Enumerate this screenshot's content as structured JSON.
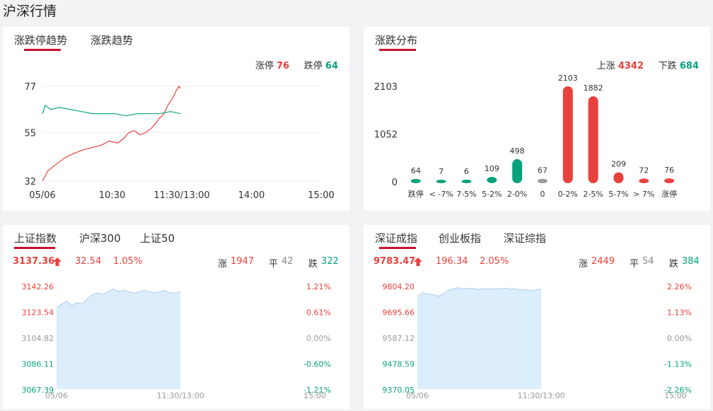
{
  "page_title": "沪深行情",
  "panels": {
    "trend": {
      "tabs": [
        "涨跌停趋势",
        "涨跌趋势"
      ],
      "legend": {
        "up_label": "涨停",
        "up_value": "76",
        "down_label": "跌停",
        "down_value": "64"
      }
    },
    "distribution": {
      "tabs": [
        "涨跌分布"
      ],
      "legend": {
        "up_label": "上涨",
        "up_value": "4342",
        "down_label": "下跌",
        "down_value": "684"
      }
    },
    "sh": {
      "tabs": [
        "上证指数",
        "沪深300",
        "上证50"
      ],
      "price": "3137.36",
      "change": "32.54",
      "pct": "1.05%",
      "up_label": "涨",
      "up_value": "1947",
      "flat_label": "平",
      "flat_value": "42",
      "down_label": "跌",
      "down_value": "322"
    },
    "sz": {
      "tabs": [
        "深证成指",
        "创业板指",
        "深证综指"
      ],
      "price": "9783.47",
      "change": "196.34",
      "pct": "2.05%",
      "up_label": "涨",
      "up_value": "2449",
      "flat_label": "平",
      "flat_value": "54",
      "down_label": "跌",
      "down_value": "384"
    }
  },
  "colors": {
    "up": "#e8413e",
    "down": "#08a27c",
    "flat": "#999999",
    "accent": "#c8102e",
    "area": "#dcedfc",
    "area_line": "#a9cdf0"
  },
  "chart_data": [
    {
      "id": "limit-trend",
      "type": "line",
      "x_ticks": [
        "05/06",
        "10:30",
        "11:30/13:00",
        "14:00",
        "15:00"
      ],
      "y_ticks": [
        77,
        55,
        32
      ],
      "ylim": [
        32,
        77
      ],
      "session_end_fraction": 0.495,
      "series": [
        {
          "color": "#e8413e",
          "points": [
            [
              0,
              32
            ],
            [
              0.02,
              37
            ],
            [
              0.05,
              40
            ],
            [
              0.08,
              43
            ],
            [
              0.11,
              45
            ],
            [
              0.15,
              47
            ],
            [
              0.18,
              48
            ],
            [
              0.21,
              49
            ],
            [
              0.24,
              51
            ],
            [
              0.27,
              50
            ],
            [
              0.29,
              52
            ],
            [
              0.31,
              55
            ],
            [
              0.33,
              56
            ],
            [
              0.35,
              54
            ],
            [
              0.37,
              55
            ],
            [
              0.39,
              57
            ],
            [
              0.41,
              60
            ],
            [
              0.42,
              62
            ],
            [
              0.43,
              63
            ],
            [
              0.44,
              65
            ],
            [
              0.45,
              68
            ],
            [
              0.46,
              70
            ],
            [
              0.47,
              72
            ],
            [
              0.48,
              75
            ],
            [
              0.49,
              77
            ],
            [
              0.495,
              76
            ]
          ]
        },
        {
          "color": "#08a27c",
          "points": [
            [
              0,
              64
            ],
            [
              0.01,
              68
            ],
            [
              0.03,
              66
            ],
            [
              0.06,
              67
            ],
            [
              0.1,
              66
            ],
            [
              0.14,
              65
            ],
            [
              0.18,
              64
            ],
            [
              0.22,
              64
            ],
            [
              0.26,
              64
            ],
            [
              0.3,
              63
            ],
            [
              0.34,
              64
            ],
            [
              0.38,
              64
            ],
            [
              0.42,
              64
            ],
            [
              0.46,
              65
            ],
            [
              0.495,
              64
            ]
          ]
        }
      ]
    },
    {
      "id": "distribution",
      "type": "bar",
      "categories": [
        "跌停",
        "< -7%",
        "7-5%",
        "5-2%",
        "2-0%",
        "0",
        "0-2%",
        "2-5%",
        "5-7%",
        "> 7%",
        "涨停"
      ],
      "values": [
        64,
        7,
        6,
        109,
        498,
        67,
        2103,
        1882,
        209,
        72,
        76
      ],
      "bar_colors": [
        "#08a27c",
        "#08a27c",
        "#08a27c",
        "#08a27c",
        "#08a27c",
        "#999999",
        "#e8413e",
        "#e8413e",
        "#e8413e",
        "#e8413e",
        "#e8413e"
      ],
      "y_ticks": [
        2103,
        1052,
        0
      ],
      "ylim": [
        0,
        2103
      ]
    },
    {
      "id": "sh-intraday",
      "type": "area",
      "x_ticks": [
        "05/06",
        "11:30/13:00",
        "15:00"
      ],
      "y_ticks_left": [
        "3142.26",
        "3123.54",
        "3104.82",
        "3086.11",
        "3067.39"
      ],
      "y_ticks_right": [
        "1.21%",
        "0.61%",
        "0.00%",
        "-0.60%",
        "-1.21%"
      ],
      "ylim": [
        3067.39,
        3142.26
      ],
      "session_end_fraction": 0.48,
      "points": [
        [
          0,
          3126
        ],
        [
          0.02,
          3129
        ],
        [
          0.04,
          3131
        ],
        [
          0.06,
          3128
        ],
        [
          0.08,
          3130
        ],
        [
          0.1,
          3129
        ],
        [
          0.12,
          3133
        ],
        [
          0.14,
          3136
        ],
        [
          0.16,
          3137
        ],
        [
          0.18,
          3136
        ],
        [
          0.2,
          3138
        ],
        [
          0.22,
          3140
        ],
        [
          0.24,
          3138
        ],
        [
          0.26,
          3139
        ],
        [
          0.28,
          3138
        ],
        [
          0.3,
          3137
        ],
        [
          0.32,
          3138
        ],
        [
          0.34,
          3139
        ],
        [
          0.36,
          3138
        ],
        [
          0.38,
          3137
        ],
        [
          0.4,
          3138
        ],
        [
          0.42,
          3139
        ],
        [
          0.44,
          3137
        ],
        [
          0.46,
          3137
        ],
        [
          0.48,
          3138
        ]
      ]
    },
    {
      "id": "sz-intraday",
      "type": "area",
      "x_ticks": [
        "05/06",
        "11:30/13:00",
        "15:00"
      ],
      "y_ticks_left": [
        "9804.20",
        "9695.66",
        "9587.12",
        "9478.59",
        "9370.05"
      ],
      "y_ticks_right": [
        "2.26%",
        "1.13%",
        "0.00%",
        "-1.13%",
        "-2.26%"
      ],
      "ylim": [
        9370.05,
        9804.2
      ],
      "session_end_fraction": 0.48,
      "points": [
        [
          0,
          9760
        ],
        [
          0.02,
          9775
        ],
        [
          0.04,
          9770
        ],
        [
          0.06,
          9768
        ],
        [
          0.08,
          9760
        ],
        [
          0.1,
          9770
        ],
        [
          0.12,
          9785
        ],
        [
          0.14,
          9792
        ],
        [
          0.16,
          9796
        ],
        [
          0.18,
          9790
        ],
        [
          0.2,
          9794
        ],
        [
          0.22,
          9792
        ],
        [
          0.24,
          9789
        ],
        [
          0.26,
          9792
        ],
        [
          0.28,
          9790
        ],
        [
          0.3,
          9792
        ],
        [
          0.32,
          9791
        ],
        [
          0.34,
          9794
        ],
        [
          0.36,
          9790
        ],
        [
          0.38,
          9792
        ],
        [
          0.4,
          9787
        ],
        [
          0.42,
          9789
        ],
        [
          0.44,
          9783
        ],
        [
          0.46,
          9788
        ],
        [
          0.48,
          9790
        ]
      ]
    }
  ]
}
